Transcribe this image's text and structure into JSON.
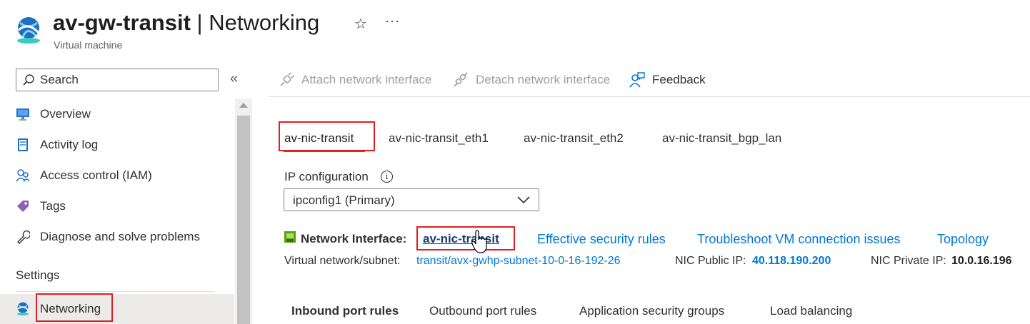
{
  "header": {
    "title_name": "av-gw-transit",
    "title_sep": " | ",
    "title_section": "Networking",
    "subtitle": "Virtual machine",
    "star_glyph": "☆",
    "more_glyph": "···"
  },
  "sidebar": {
    "search_placeholder": "Search",
    "collapse_glyph": "«",
    "items": [
      {
        "label": "Overview",
        "icon": "monitor-icon"
      },
      {
        "label": "Activity log",
        "icon": "activity-log-icon"
      },
      {
        "label": "Access control (IAM)",
        "icon": "people-icon"
      },
      {
        "label": "Tags",
        "icon": "tag-icon"
      },
      {
        "label": "Diagnose and solve problems",
        "icon": "wrench-icon"
      }
    ],
    "section": "Settings",
    "active_item": {
      "label": "Networking",
      "icon": "networking-icon"
    }
  },
  "toolbar": {
    "attach": "Attach network interface",
    "detach": "Detach network interface",
    "feedback": "Feedback"
  },
  "nic_tabs": [
    "av-nic-transit",
    "av-nic-transit_eth1",
    "av-nic-transit_eth2",
    "av-nic-transit_bgp_lan"
  ],
  "ip_config": {
    "label": "IP configuration",
    "info_glyph": "i",
    "selected": "ipconfig1 (Primary)"
  },
  "nic_info": {
    "label": "Network Interface:",
    "nic_link": "av-nic-transit",
    "links": [
      "Effective security rules",
      "Troubleshoot VM connection issues",
      "Topology"
    ],
    "vnet_label": "Virtual network/subnet:",
    "vnet_value": "transit/avx-gwhp-subnet-10-0-16-192-26",
    "public_ip_label": "NIC Public IP:",
    "public_ip": "40.118.190.200",
    "private_ip_label": "NIC Private IP:",
    "private_ip": "10.0.16.196"
  },
  "rule_tabs": [
    "Inbound port rules",
    "Outbound port rules",
    "Application security groups",
    "Load balancing"
  ],
  "colors": {
    "accent": "#0078d4",
    "highlight_box": "#e01e22",
    "text": "#323130"
  }
}
